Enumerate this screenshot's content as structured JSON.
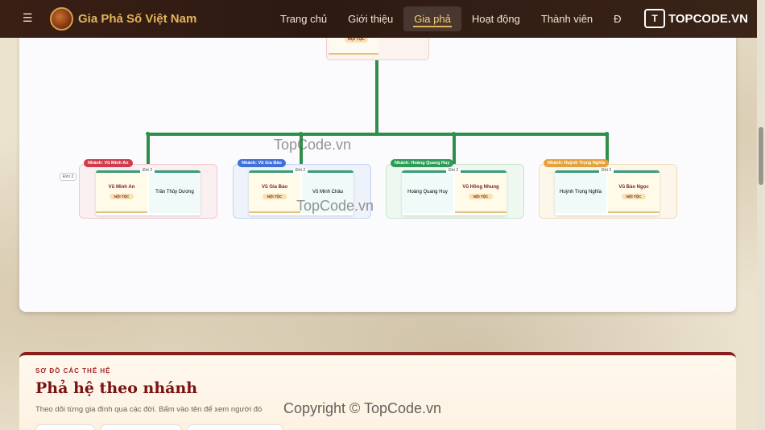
{
  "header": {
    "menu_icon": "hamburger-icon",
    "brand": "Gia Phả Số Việt Nam",
    "nav": [
      {
        "label": "Trang chủ",
        "active": false
      },
      {
        "label": "Giới thiệu",
        "active": false
      },
      {
        "label": "Gia phả",
        "active": true
      },
      {
        "label": "Hoạt động",
        "active": false
      },
      {
        "label": "Thành viên",
        "active": false
      },
      {
        "label": "Đ",
        "active": false
      }
    ],
    "watermark": "TOPCODE.VN"
  },
  "tree": {
    "root": {
      "tag": "NỘI TỘC"
    },
    "gen_label": "Đời 2",
    "branches": [
      {
        "tag": "Nhánh: Vũ Minh An",
        "color": "#d23b4c",
        "gen": "Đời 2",
        "left": {
          "name": "Vũ Minh An",
          "tag": "NỘI TỘC",
          "main": true
        },
        "right": {
          "name": "Trần Thủy Dương",
          "main": false
        }
      },
      {
        "tag": "Nhánh: Vũ Gia Bảo",
        "color": "#3f6fd8",
        "gen": "Đời 2",
        "left": {
          "name": "Vũ Gia Bảo",
          "tag": "NỘI TỘC",
          "main": true
        },
        "right": {
          "name": "Võ Minh Châu",
          "main": false
        }
      },
      {
        "tag": "Nhánh: Hoàng Quang Huy",
        "color": "#2e9b57",
        "gen": "Đời 2",
        "left": {
          "name": "Hoàng Quang Huy",
          "main": false
        },
        "right": {
          "name": "Vũ Hồng Nhung",
          "tag": "NỘI TỘC",
          "main": true
        }
      },
      {
        "tag": "Nhánh: Huỳnh Trọng Nghĩa",
        "color": "#e6a23a",
        "gen": "Đời 2",
        "left": {
          "name": "Huỳnh Trọng Nghĩa",
          "main": false
        },
        "right": {
          "name": "Vũ Bảo Ngọc",
          "tag": "NỘI TỘC",
          "main": true
        }
      }
    ]
  },
  "section": {
    "kicker": "SƠ ĐỒ CÁC THẾ HỆ",
    "title": "Phả hệ theo nhánh",
    "desc": "Theo dõi từng gia đình qua các đời. Bấm vào tên để xem người đó"
  },
  "watermarks": [
    "TopCode.vn",
    "TopCode.vn",
    "Copyright © TopCode.vn"
  ],
  "colors": {
    "header": "#2c1a12",
    "accent": "#e3b45c",
    "line": "#2f8f4a",
    "title": "#7a1212"
  }
}
